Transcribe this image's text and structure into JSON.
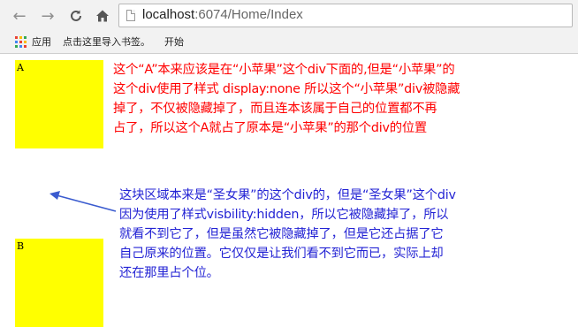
{
  "browser": {
    "url_host": "localhost",
    "url_path": ":6074/Home/Index",
    "bookmarks": [
      "应用",
      "点击这里导入书签。",
      "开始"
    ]
  },
  "content": {
    "box_a_label": "A",
    "box_b_label": "B",
    "note_red_lines": [
      "这个“A”本来应该是在“小苹果”这个div下面的,但是“小苹果”的",
      "这个div使用了样式 display:none 所以这个“小苹果”div被隐藏",
      "掉了，不仅被隐藏掉了，而且连本该属于自己的位置都不再",
      "占了，所以这个A就占了原本是“小苹果”的那个div的位置"
    ],
    "note_blue_lines": [
      "这块区域本来是“圣女果”的这个div的，但是“圣女果”这个div",
      "因为使用了样式visbility:hidden，所以它被隐藏掉了，所以",
      "就看不到它了，但是虽然它被隐藏掉了，但是它还占据了它",
      "自己原来的位置。它仅仅是让我们看不到它而已，实际上却",
      "还在那里占个位。"
    ]
  },
  "colors": {
    "box": "#ffff00",
    "red_text": "#ff0000",
    "blue_text": "#2323d4",
    "arrow": "#3a5bcf"
  },
  "icons": [
    "back-arrow-icon",
    "forward-arrow-icon",
    "reload-icon",
    "home-icon",
    "page-icon",
    "apps-grid-icon"
  ]
}
